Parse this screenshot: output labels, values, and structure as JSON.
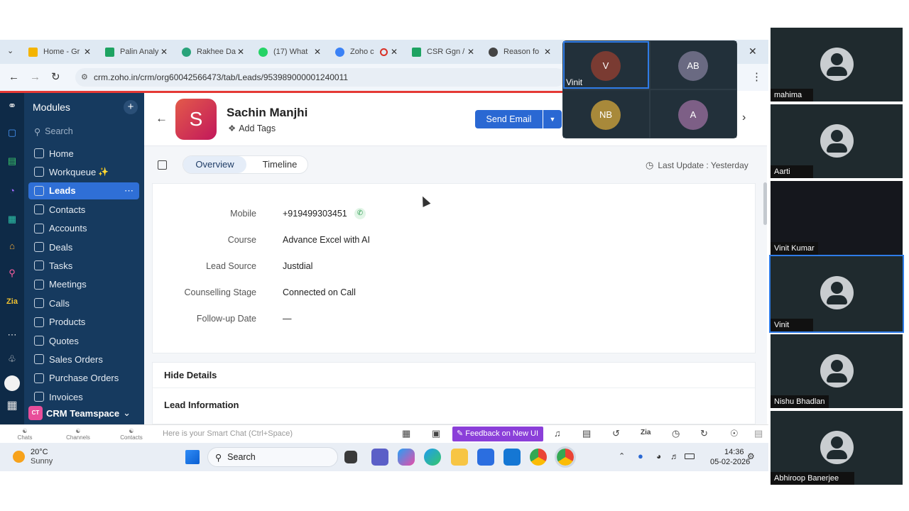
{
  "browser": {
    "tabs": [
      {
        "label": "Home - Gr",
        "color": "#4285f4"
      },
      {
        "label": "Palin Analy",
        "color": "#1ea362"
      },
      {
        "label": "Rakhee Da",
        "color": "#29a37a"
      },
      {
        "label": "(17) What",
        "color": "#25d366"
      },
      {
        "label": "Zoho c",
        "color": "#3b82f6"
      },
      {
        "label": "CSR Ggn /",
        "color": "#1ea362"
      },
      {
        "label": "Reason fo",
        "color": "#444444"
      }
    ],
    "url": "crm.zoho.in/crm/org60042566473/tab/Leads/953989000001240011"
  },
  "sidebar": {
    "title": "Modules",
    "search_placeholder": "Search",
    "items": [
      "Home",
      "Workqueue",
      "Leads",
      "Contacts",
      "Accounts",
      "Deals",
      "Tasks",
      "Meetings",
      "Calls",
      "Products",
      "Quotes",
      "Sales Orders",
      "Purchase Orders",
      "Invoices"
    ],
    "active": "Leads",
    "workspace_badge": "CT",
    "workspace": "CRM Teamspace"
  },
  "record": {
    "avatar_letter": "S",
    "name": "Sachin Manjhi",
    "add_tags": "Add Tags",
    "send_email": "Send Email",
    "tabs": [
      "Overview",
      "Timeline"
    ],
    "last_update": "Last Update : Yesterday",
    "fields": [
      {
        "label": "Mobile",
        "value": "+919499303451"
      },
      {
        "label": "Course",
        "value": "Advance Excel with AI"
      },
      {
        "label": "Lead Source",
        "value": "Justdial"
      },
      {
        "label": "Counselling Stage",
        "value": "Connected on Call"
      },
      {
        "label": "Follow-up Date",
        "value": "—"
      }
    ],
    "hide_details": "Hide Details",
    "lead_information": "Lead Information"
  },
  "zoho_bar": {
    "chats": "Chats",
    "channels": "Channels",
    "contacts": "Contacts",
    "smart_chat": "Here is your Smart Chat (Ctrl+Space)",
    "feedback": "Feedback on New UI"
  },
  "taskbar": {
    "temp": "20°C",
    "weather": "Sunny",
    "search": "Search",
    "time": "14:36",
    "date": "05-02-2026"
  },
  "meeting_popup": {
    "tiles": [
      {
        "initials": "V",
        "name": "Vinit",
        "color": "#7a3b32"
      },
      {
        "initials": "AB",
        "name": "",
        "color": "#6a6a82"
      },
      {
        "initials": "NB",
        "name": "",
        "color": "#a8893a"
      },
      {
        "initials": "A",
        "name": "",
        "color": "#7d5f86"
      }
    ]
  },
  "participants": [
    "mahima",
    "Aarti",
    "Vinit Kumar",
    "Vinit",
    "Nishu Bhadlan",
    "Abhiroop Banerjee"
  ]
}
